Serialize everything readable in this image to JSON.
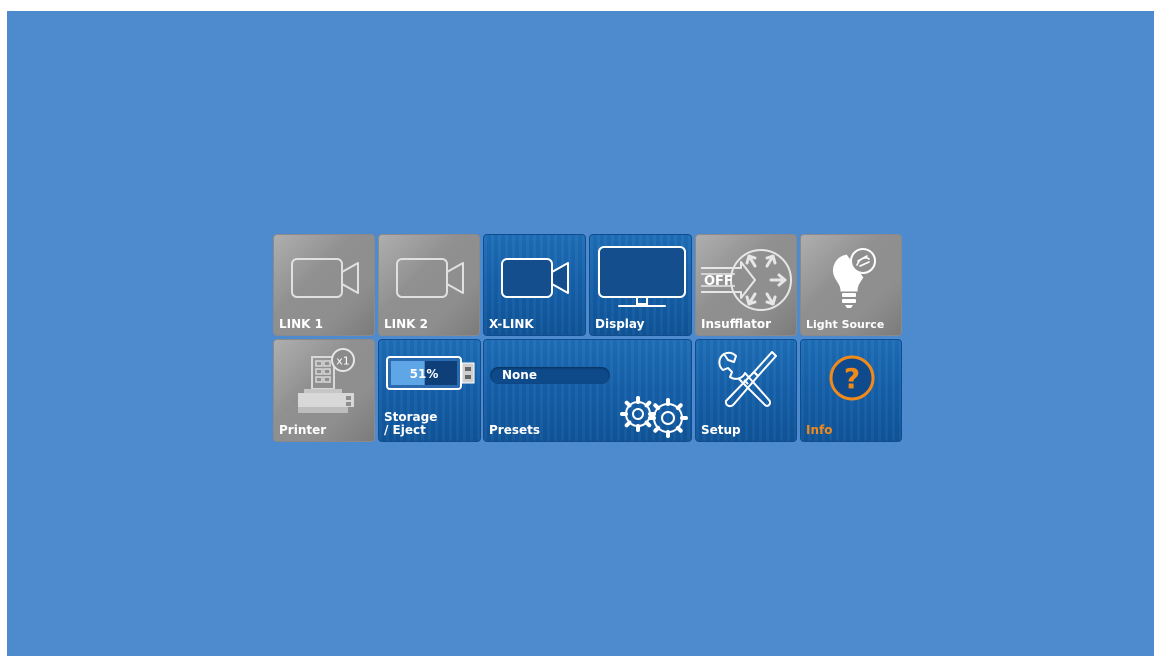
{
  "tiles": {
    "link1": {
      "label": "LINK 1",
      "icon": "camera-icon"
    },
    "link2": {
      "label": "LINK 2",
      "icon": "camera-icon"
    },
    "xlink": {
      "label": "X-LINK",
      "icon": "camera-icon"
    },
    "display": {
      "label": "Display",
      "icon": "monitor-icon"
    },
    "insufflator": {
      "label": "Insufflator",
      "icon": "insufflator-icon",
      "state_text": "OFF"
    },
    "light_source": {
      "label": "Light Source",
      "icon": "lightbulb-icon"
    },
    "printer": {
      "label": "Printer",
      "icon": "printer-icon",
      "badge": "x1"
    },
    "storage": {
      "label_line1": "Storage",
      "label_line2": "/ Eject",
      "icon": "usb-drive-icon",
      "fill_text": "51%",
      "fill_level": 0.51
    },
    "presets": {
      "label": "Presets",
      "value": "None",
      "icon": "gears-icon"
    },
    "setup": {
      "label": "Setup",
      "icon": "tools-icon"
    },
    "info": {
      "label": "Info",
      "icon": "question-icon",
      "glyph": "?"
    }
  },
  "colors": {
    "background": "#4d8bce",
    "tile_blue": "#1560aa",
    "tile_gray": "#8e8e8e",
    "info_accent": "#f08a1a"
  }
}
